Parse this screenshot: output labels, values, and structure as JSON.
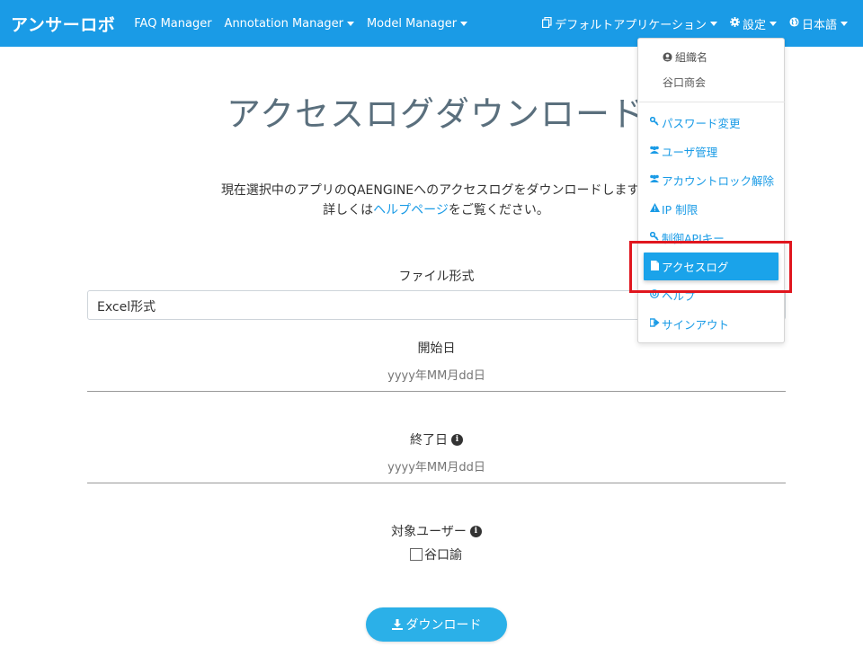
{
  "navbar": {
    "brand": "アンサーロボ",
    "menu": [
      {
        "label": "FAQ Manager",
        "has_caret": false
      },
      {
        "label": "Annotation Manager",
        "has_caret": true
      },
      {
        "label": "Model Manager",
        "has_caret": true
      }
    ],
    "app_selector": "デフォルトアプリケーション",
    "settings": "設定",
    "language": "日本語"
  },
  "page": {
    "title": "アクセスログダウンロード",
    "desc_line1": "現在選択中のアプリのQAENGINEへのアクセスログをダウンロードします。",
    "desc_line2_pre": "詳しくは",
    "desc_line2_link": "ヘルプページ",
    "desc_line2_post": "をご覧ください。"
  },
  "form": {
    "file_format_label": "ファイル形式",
    "file_format_value": "Excel形式",
    "start_date_label": "開始日",
    "start_date_placeholder": "yyyy年MM月dd日",
    "end_date_label": "終了日",
    "end_date_placeholder": "yyyy年MM月dd日",
    "target_user_label": "対象ユーザー",
    "user_option": "谷口諭",
    "download_button": "ダウンロード"
  },
  "dropdown": {
    "org_header": "組織名",
    "org_name": "谷口商会",
    "items": [
      {
        "label": "パスワード変更",
        "icon": "key-icon"
      },
      {
        "label": "ユーザ管理",
        "icon": "users-icon"
      },
      {
        "label": "アカウントロック解除",
        "icon": "users-icon"
      },
      {
        "label": "IP 制限",
        "icon": "warning-icon"
      },
      {
        "label": "制御APIキー",
        "icon": "key-icon"
      },
      {
        "label": "アクセスログ",
        "icon": "file-icon",
        "active": true
      },
      {
        "label": "ヘルプ",
        "icon": "help-icon"
      },
      {
        "label": "サインアウト",
        "icon": "sign-out-icon"
      }
    ]
  },
  "colors": {
    "navbar": "#1a9be6",
    "accent": "#1aa3ea",
    "highlight": "#e0161e"
  }
}
